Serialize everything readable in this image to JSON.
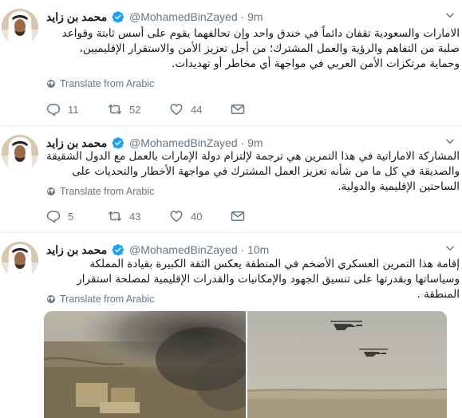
{
  "tweets": [
    {
      "display_name": "محمد بن زايد",
      "handle": "@MohamedBinZayed",
      "separator": "·",
      "time": "9m",
      "text": "الامارات والسعودية تقفان دائماً في خندق واحد وإن تحالفهما يقوم على أسس ثابتة وقواعد صلبة من التفاهم والرؤية والعمل المشترك؛ من أجل تعزيز الأمن والاستقرار الإقليميين، وحماية مرتكزات الأمن العربي في مواجهة أي مخاطر أو تهديدات.",
      "translate_label": "Translate from Arabic",
      "replies": "11",
      "retweets": "52",
      "likes": "44"
    },
    {
      "display_name": "محمد بن زايد",
      "handle": "@MohamedBinZayed",
      "separator": "·",
      "time": "9m",
      "text": "المشاركة الاماراتية في هذا التمرين هي ترجمة لإلتزام دولة الإمارات بالعمل مع الدول الشقيقة والصديقة في كل ما من شأنه تعزيز العمل المشترك في مواجهة الأخطار والتحديات على الساحتين الإقليمية والدولية.",
      "translate_label": "Translate from Arabic",
      "replies": "5",
      "retweets": "43",
      "likes": "40"
    },
    {
      "display_name": "محمد بن زايد",
      "handle": "@MohamedBinZayed",
      "separator": "·",
      "time": "10m",
      "text": "إقامة هذا التمرين العسكري الأضخم في المنطقة يعكس الثقة الكبيرة بقيادة المملكة وسياساتها وبقدرتها على تنسيق الجهود والإمكانيات والقدرات الإقليمية لمصلحة استقرار المنطقة .",
      "translate_label": "Translate from Arabic"
    }
  ],
  "colors": {
    "verified": "#1da1f2",
    "muted": "#657786",
    "text": "#14171a",
    "divider": "#e6ecf0"
  },
  "icons": [
    "verified-badge-icon",
    "chevron-down-icon",
    "globe-icon",
    "reply-icon",
    "retweet-icon",
    "like-icon",
    "direct-message-icon"
  ]
}
